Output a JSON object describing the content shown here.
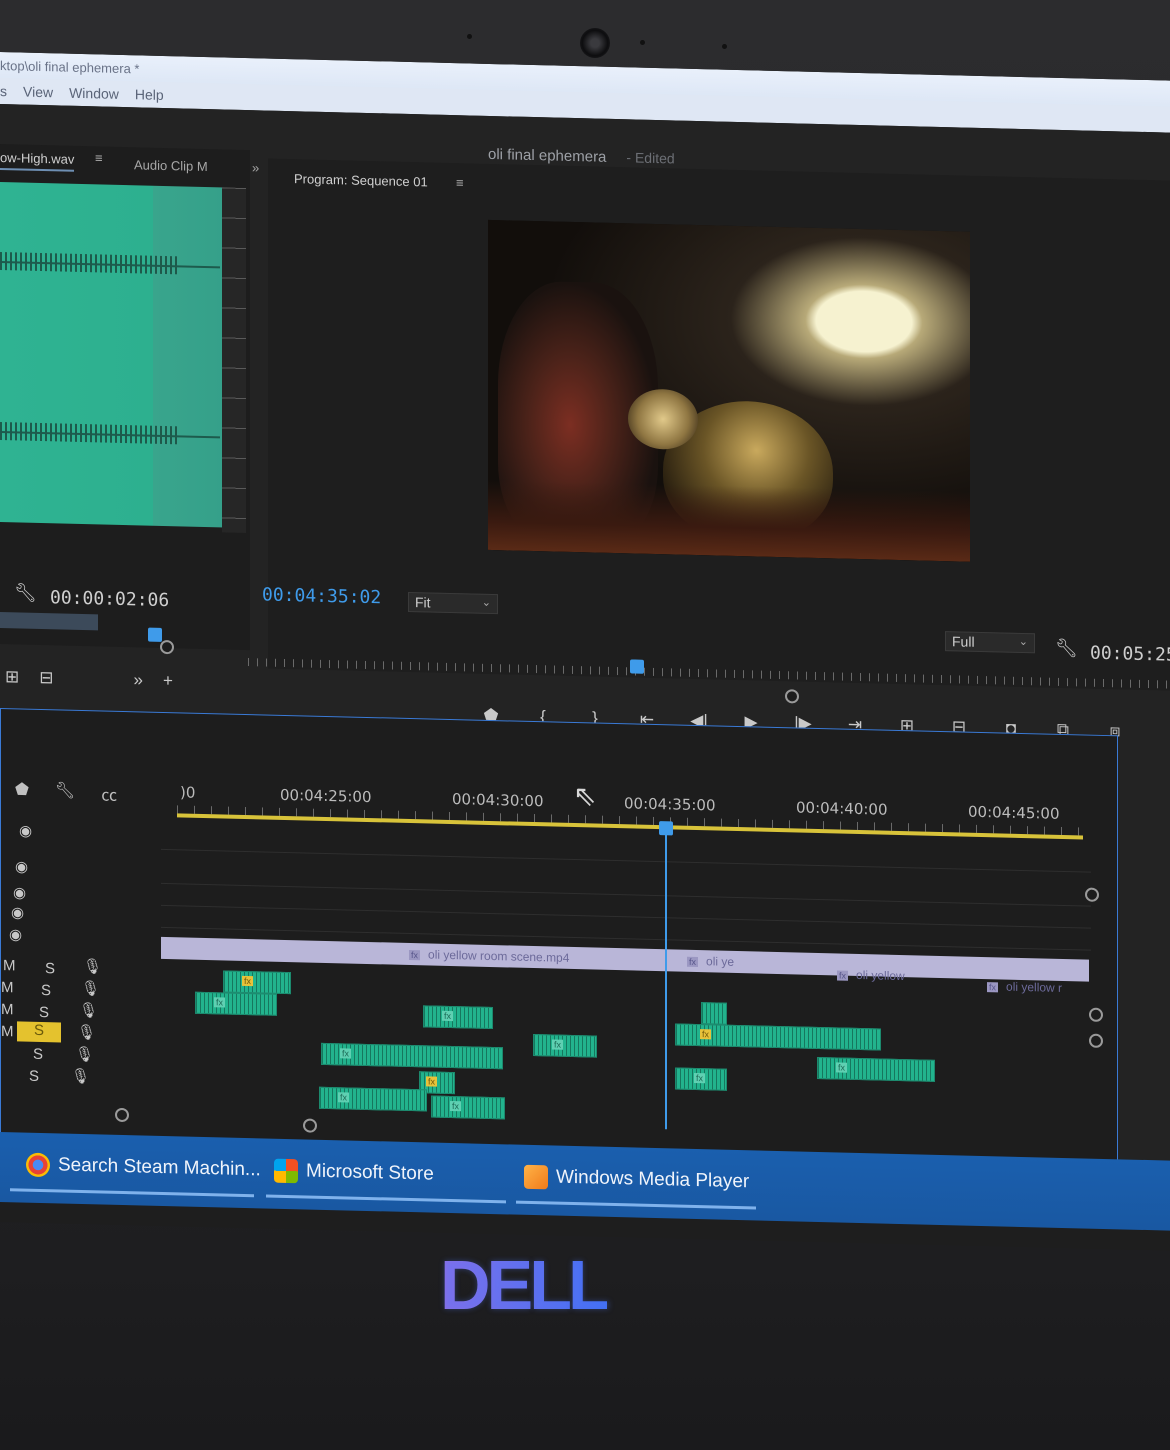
{
  "window": {
    "path_title": "ktop\\oli final ephemera *",
    "menu": [
      "s",
      "View",
      "Window",
      "Help"
    ],
    "project_title": "oli final ephemera",
    "project_status": "- Edited"
  },
  "source_panel": {
    "tab_file": "ow-High.wav",
    "tab_audio_clip": "Audio Clip M",
    "overflow": "»",
    "timecode": "00:00:02:06"
  },
  "program_panel": {
    "title": "Program: Sequence 01",
    "timecode": "00:04:35:02",
    "fit_select": "Fit",
    "quality_select": "Full",
    "duration": "00:05:25"
  },
  "timeline": {
    "time_labels": [
      ")0",
      "00:04:25:00",
      "00:04:30:00",
      "00:04:35:00",
      "00:04:40:00",
      "00:04:45:00"
    ],
    "video_clips": [
      "oli yellow room scene.mp4",
      "oli ye",
      "oli yellow",
      "oli yellow r"
    ],
    "track_m": "M",
    "track_s": "S",
    "fx": "fx"
  },
  "taskbar": {
    "items": [
      {
        "label": "Search Steam Machin...",
        "icon": "chrome-icon"
      },
      {
        "label": "Microsoft Store",
        "icon": "store-icon"
      },
      {
        "label": "Windows Media Player",
        "icon": "media-player-icon"
      }
    ]
  },
  "brand": {
    "logo": "DELL"
  },
  "colors": {
    "accent_blue": "#3f9bea",
    "audio_clip": "#22b38d",
    "work_area_yellow": "#d8c33a",
    "taskbar": "#1a5fae"
  }
}
